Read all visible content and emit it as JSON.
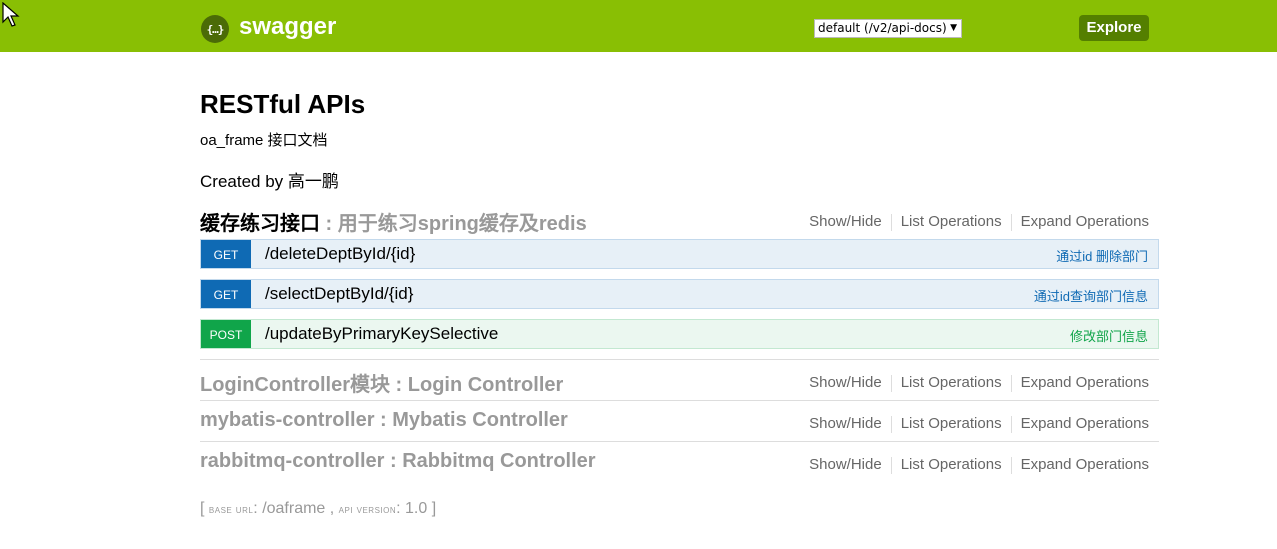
{
  "header": {
    "logo_glyph": "{…}",
    "logo_text": "swagger",
    "api_select_value": "default (/v2/api-docs)",
    "explore_label": "Explore",
    "brand_color": "#89bf04"
  },
  "info": {
    "title": "RESTful APIs",
    "description": "oa_frame 接口文档",
    "created_prefix": "Created by ",
    "created_name": "高一鹏"
  },
  "links": {
    "show_hide": "Show/Hide",
    "list_operations": "List Operations",
    "expand_operations": "Expand Operations"
  },
  "resources": [
    {
      "name": "缓存练习接口",
      "description": " : 用于练习spring缓存及redis",
      "operations": [
        {
          "method": "GET",
          "path": "/deleteDeptById/{id}",
          "summary": "通过id 删除部门"
        },
        {
          "method": "GET",
          "path": "/selectDeptById/{id}",
          "summary": "通过id查询部门信息"
        },
        {
          "method": "POST",
          "path": "/updateByPrimaryKeySelective",
          "summary": "修改部门信息"
        }
      ]
    },
    {
      "name": "LoginController模块",
      "description": " : Login Controller"
    },
    {
      "name": "mybatis-controller",
      "description": " : Mybatis Controller"
    },
    {
      "name": "rabbitmq-controller",
      "description": " : Rabbitmq Controller"
    }
  ],
  "footer": {
    "open": "[ ",
    "base_url_label": "base url",
    "base_url_value": ": /oaframe , ",
    "api_version_label": "api version",
    "api_version_value": ": 1.0 ]"
  }
}
